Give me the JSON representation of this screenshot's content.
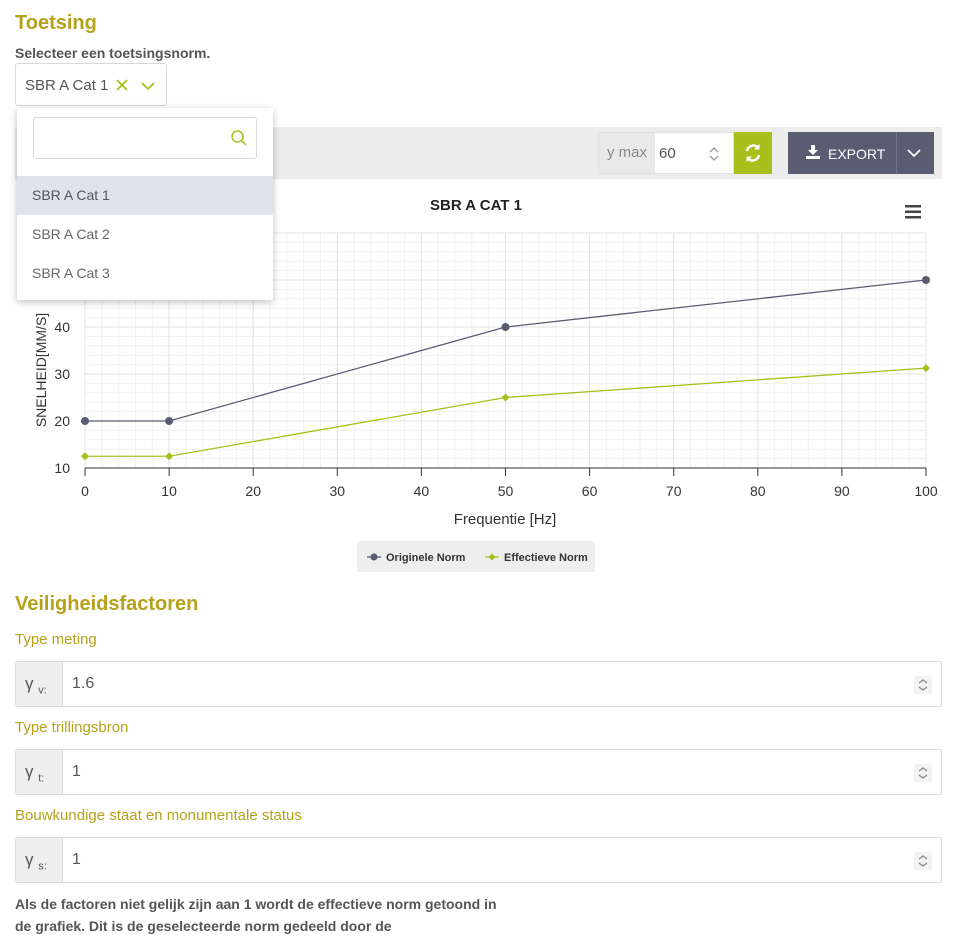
{
  "section": {
    "title": "Toetsing",
    "select_prompt": "Selecteer een toetsingsnorm."
  },
  "norm_select": {
    "value": "SBR A Cat 1",
    "options": [
      "SBR A Cat 1",
      "SBR A Cat 2",
      "SBR A Cat 3"
    ],
    "search_placeholder": ""
  },
  "toolbar": {
    "ymax_label": "y max",
    "ymax_value": "60",
    "export_label": "EXPORT"
  },
  "chart_data": {
    "type": "line",
    "title": "SBR A CAT 1",
    "xlabel": "Frequentie [Hz]",
    "ylabel": "SNELHEID[MM/S]",
    "xlim": [
      0,
      100
    ],
    "ylim": [
      10,
      60
    ],
    "x_ticks": [
      "0",
      "10",
      "20",
      "30",
      "40",
      "50",
      "60",
      "70",
      "80",
      "90",
      "100"
    ],
    "y_ticks": [
      "10",
      "20",
      "30",
      "40"
    ],
    "x": [
      0,
      10,
      50,
      100
    ],
    "series": [
      {
        "name": "Originele Norm",
        "color": "#5a5d72",
        "marker": "circle",
        "values": [
          20,
          20,
          40,
          50
        ]
      },
      {
        "name": "Effectieve Norm",
        "color": "#a9bf1c",
        "marker": "diamond",
        "values": [
          12.5,
          12.5,
          25,
          31.25
        ]
      }
    ],
    "legend": "bottom-center",
    "grid": true
  },
  "factors": {
    "title": "Veiligheidsfactoren",
    "items": [
      {
        "label": "Type meting",
        "symbol": "γ",
        "sub": "v",
        "value": "1.6"
      },
      {
        "label": "Type trillingsbron",
        "symbol": "γ",
        "sub": "t",
        "value": "1"
      },
      {
        "label": "Bouwkundige staat en monumentale status",
        "symbol": "γ",
        "sub": "s",
        "value": "1"
      }
    ],
    "note": "Als de factoren niet gelijk zijn aan 1 wordt de effectieve norm getoond in de grafiek. Dit is de geselecteerde norm gedeeld door de veiligheidsfactoren."
  },
  "colors": {
    "accent": "#b5a11a",
    "brand_green": "#a9bf1c",
    "dark": "#5a5d72"
  }
}
